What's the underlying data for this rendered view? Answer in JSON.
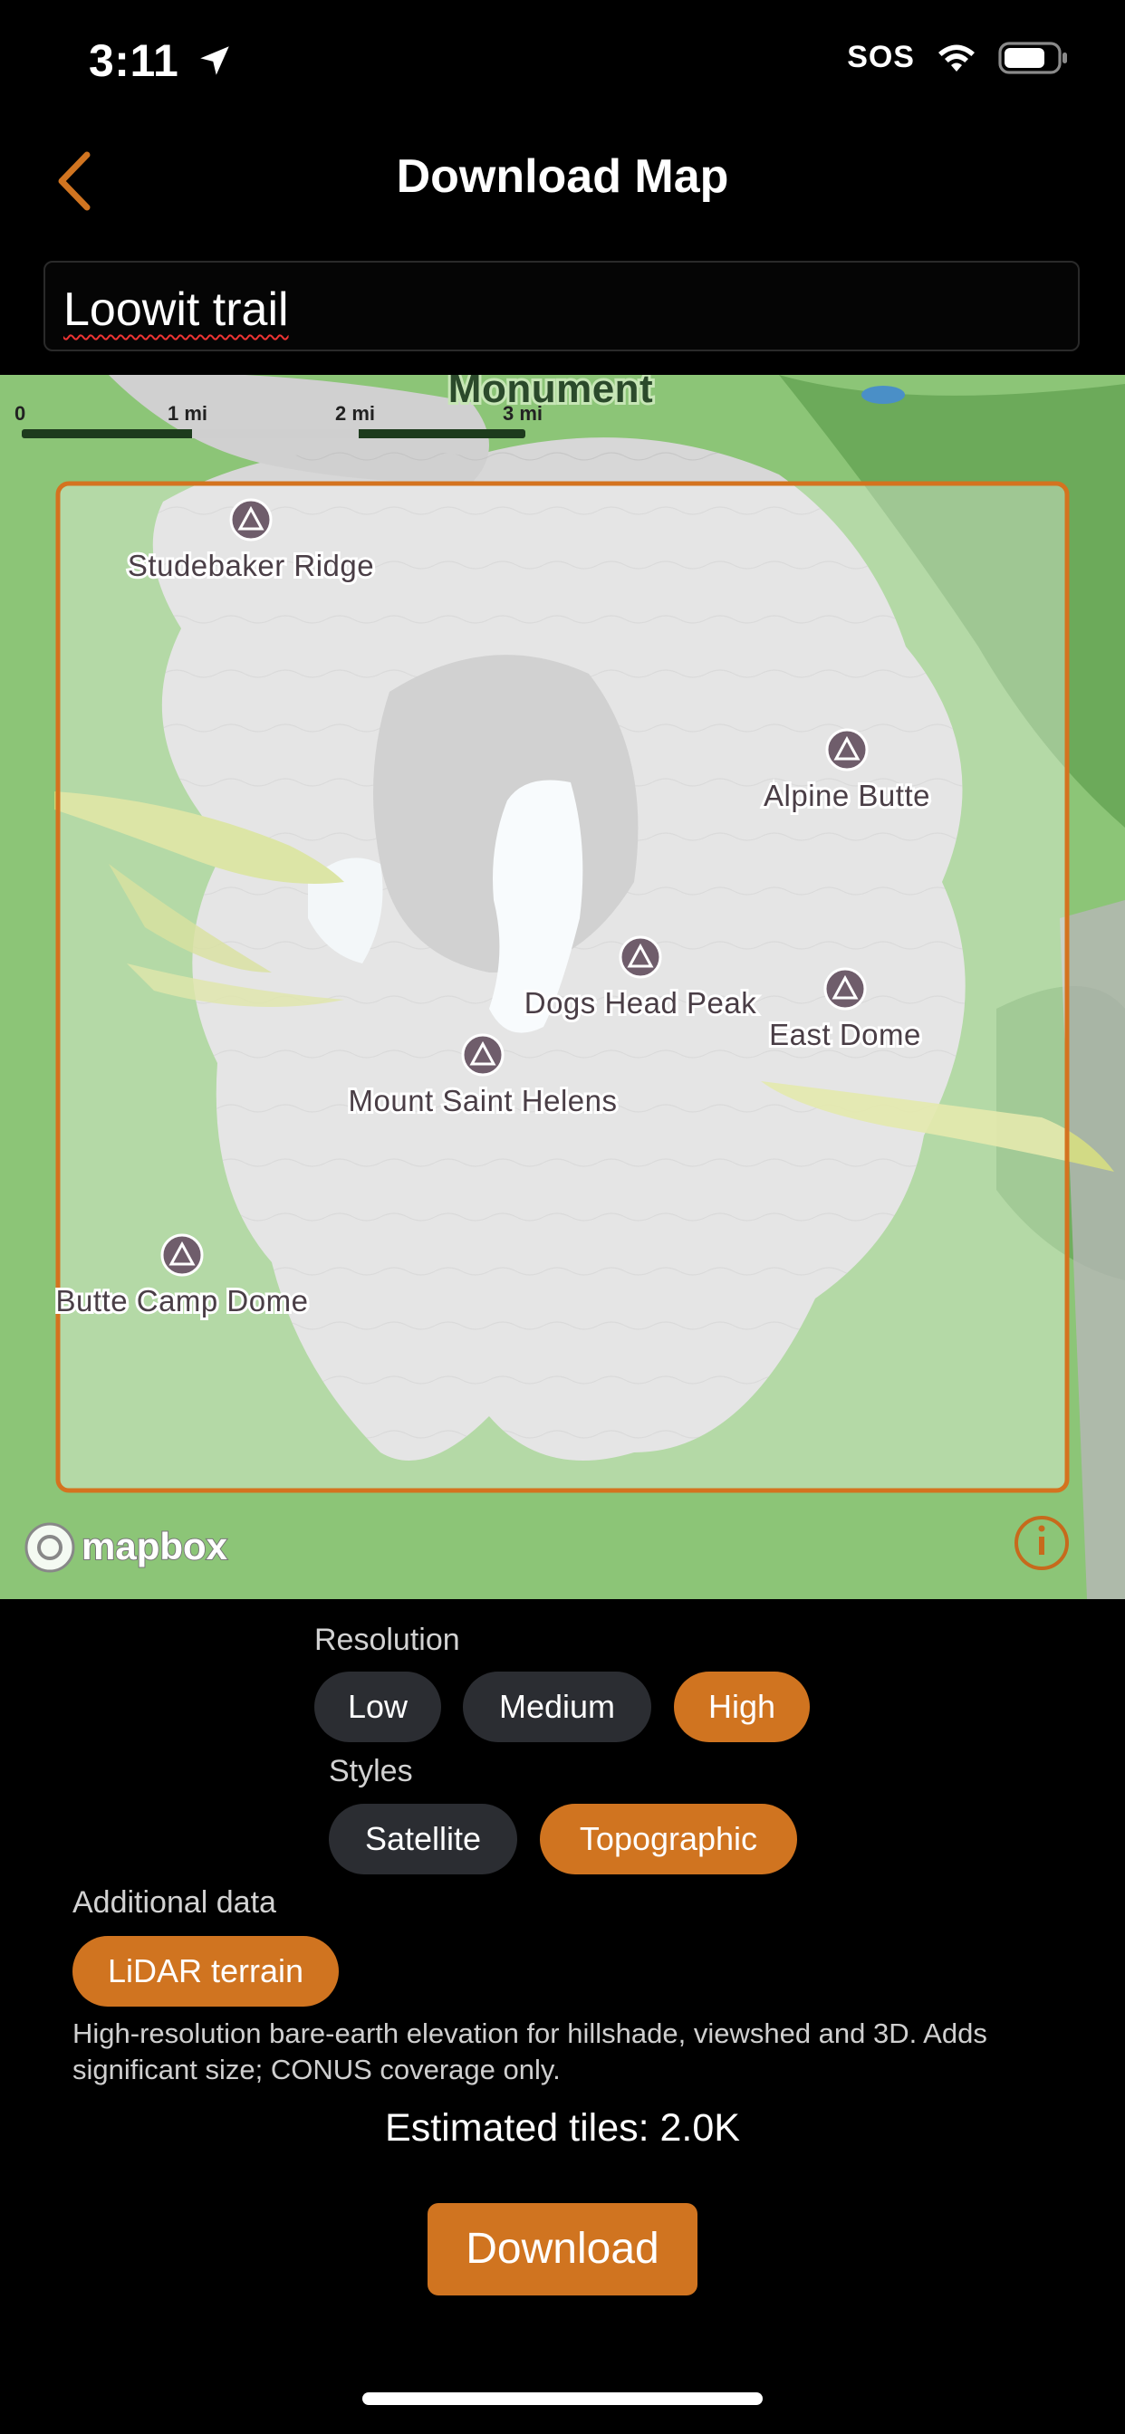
{
  "status_bar": {
    "time": "3:11",
    "sos": "SOS"
  },
  "nav": {
    "title": "Download Map"
  },
  "map_name_field": {
    "value": "Loowit trail"
  },
  "map": {
    "top_label": "Monument",
    "scale_ticks": [
      "0",
      "1 mi",
      "2 mi",
      "3 mi"
    ],
    "attribution": "mapbox",
    "peaks": [
      {
        "name": "Studebaker Ridge"
      },
      {
        "name": "Alpine Butte"
      },
      {
        "name": "Dogs Head Peak"
      },
      {
        "name": "East Dome"
      },
      {
        "name": "Mount Saint Helens"
      },
      {
        "name": "Butte Camp Dome"
      }
    ],
    "colors": {
      "selection": "#d4731f",
      "forest": "#7fbf6a",
      "rock": "#d6d6d6",
      "glacier": "#f3f8fb"
    }
  },
  "resolution": {
    "label": "Resolution",
    "options": [
      "Low",
      "Medium",
      "High"
    ],
    "selected": "High"
  },
  "styles": {
    "label": "Styles",
    "options": [
      "Satellite",
      "Topographic"
    ],
    "selected": "Topographic"
  },
  "additional": {
    "label": "Additional data",
    "option": "LiDAR terrain",
    "note": "High-resolution bare-earth elevation for hillshade, viewshed and 3D. Adds significant size; CONUS coverage only."
  },
  "estimate": {
    "text": "Estimated tiles: 2.0K"
  },
  "download_button": {
    "label": "Download"
  },
  "accent_color": "#d07420"
}
